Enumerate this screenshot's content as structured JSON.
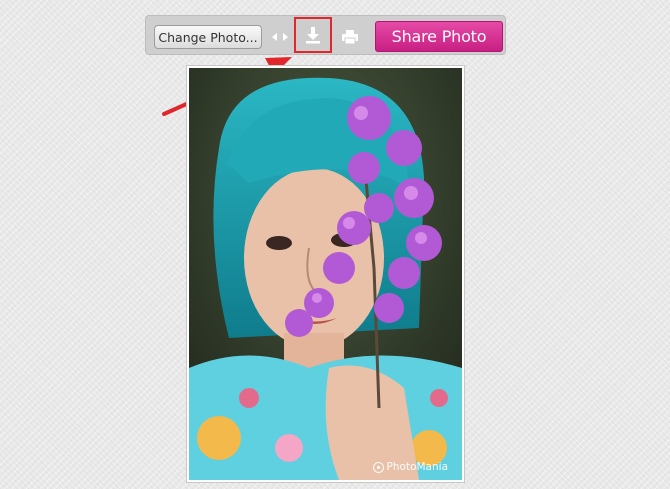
{
  "toolbar": {
    "change_photo_label": "Change Photo...",
    "compare_icon": "compare-arrows-icon",
    "download_icon": "download-icon",
    "print_icon": "print-icon",
    "share_label": "Share Photo",
    "share_color": "#d62f97",
    "highlight_color": "#e1262c"
  },
  "photo": {
    "watermark_label": "PhotoMania",
    "watermark_icon": "photomania-logo-icon"
  },
  "annotation": {
    "arrow_color": "#e1262c"
  }
}
